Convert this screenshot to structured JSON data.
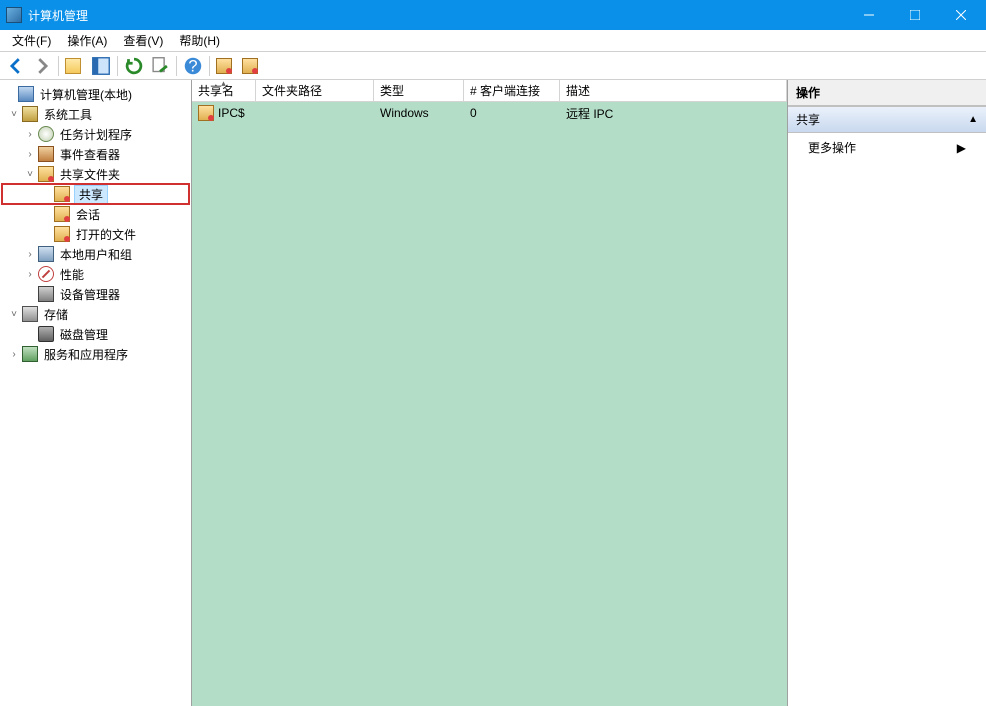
{
  "window": {
    "title": "计算机管理"
  },
  "menu": {
    "file": "文件(F)",
    "action": "操作(A)",
    "view": "查看(V)",
    "help": "帮助(H)"
  },
  "tree": {
    "root": "计算机管理(本地)",
    "system_tools": "系统工具",
    "task_scheduler": "任务计划程序",
    "event_viewer": "事件查看器",
    "shared_folders": "共享文件夹",
    "shares": "共享",
    "sessions": "会话",
    "open_files": "打开的文件",
    "local_users": "本地用户和组",
    "performance": "性能",
    "device_manager": "设备管理器",
    "storage": "存储",
    "disk_mgmt": "磁盘管理",
    "services_apps": "服务和应用程序"
  },
  "columns": {
    "share_name": "共享名",
    "folder_path": "文件夹路径",
    "type": "类型",
    "client_conn": "# 客户端连接",
    "description": "描述"
  },
  "col_widths": {
    "c1": 64,
    "c2": 118,
    "c3": 90,
    "c4": 96,
    "c5": 220
  },
  "rows": [
    {
      "name": "IPC$",
      "path": "",
      "type": "Windows",
      "clients": "0",
      "desc": "远程 IPC"
    }
  ],
  "actions": {
    "header": "操作",
    "section": "共享",
    "more": "更多操作"
  }
}
